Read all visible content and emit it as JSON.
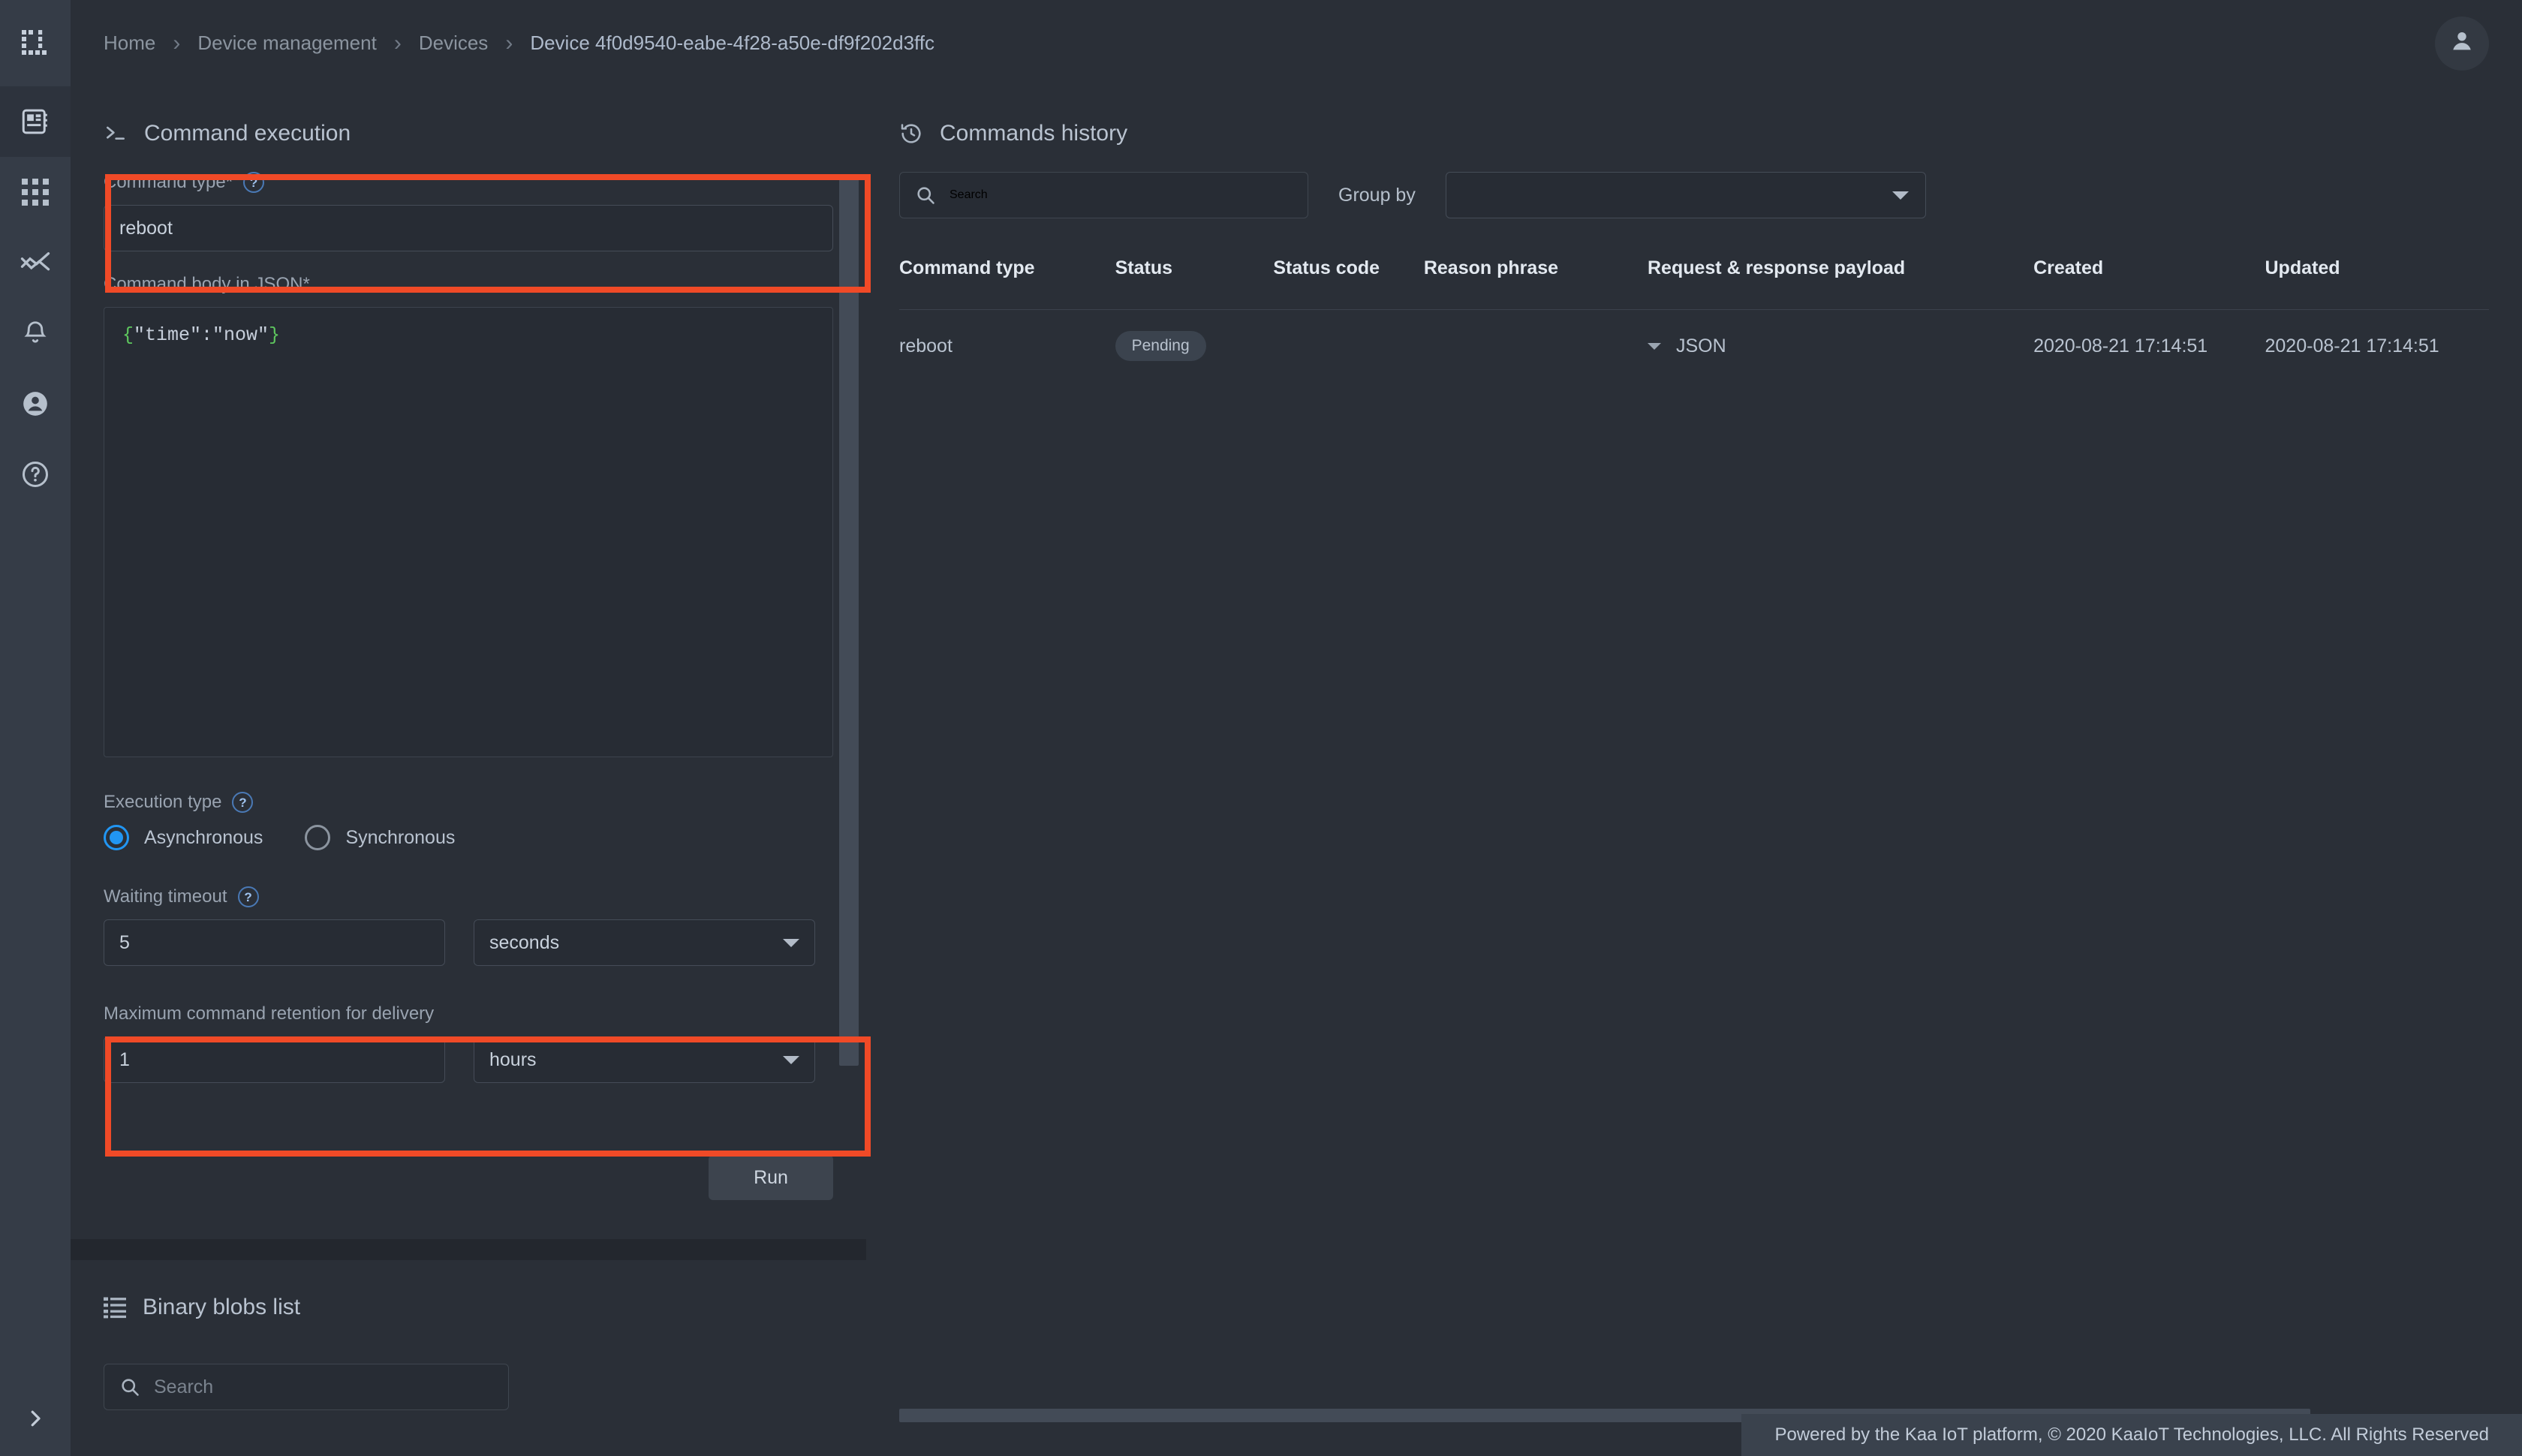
{
  "breadcrumb": {
    "items": [
      {
        "label": "Home"
      },
      {
        "label": "Device management"
      },
      {
        "label": "Devices"
      },
      {
        "label": "Device 4f0d9540-eabe-4f28-a50e-df9f202d3ffc"
      }
    ],
    "separator": "›"
  },
  "sidebar": {
    "items": [
      {
        "icon": "device-card-icon",
        "name": "devices"
      },
      {
        "icon": "grid-apps-icon",
        "name": "applications"
      },
      {
        "icon": "analytics-icon",
        "name": "analytics"
      },
      {
        "icon": "bell-icon",
        "name": "notifications"
      },
      {
        "icon": "user-icon",
        "name": "users"
      },
      {
        "icon": "help-circle-icon",
        "name": "help"
      }
    ],
    "expand_icon": "chevron-right-icon"
  },
  "topbar": {
    "account_icon": "account-avatar-icon"
  },
  "command_execution": {
    "title": "Command execution",
    "title_icon": "terminal-prompt-icon",
    "command_type": {
      "label": "Command type*",
      "help_icon": "?",
      "value": "reboot",
      "placeholder": ""
    },
    "command_body": {
      "label": "Command body in JSON*",
      "brace_open": "{",
      "code": "\"time\":\"now\"",
      "brace_close": "}"
    },
    "execution_type": {
      "label": "Execution type",
      "help_icon": "?",
      "options": [
        {
          "label": "Asynchronous",
          "selected": true
        },
        {
          "label": "Synchronous",
          "selected": false
        }
      ]
    },
    "waiting_timeout": {
      "label": "Waiting timeout",
      "help_icon": "?",
      "value": "5",
      "unit": "seconds"
    },
    "retention": {
      "label": "Maximum command retention for delivery",
      "value": "1",
      "unit": "hours"
    },
    "run_button": "Run"
  },
  "binary_blobs": {
    "title": "Binary blobs list",
    "title_icon": "list-icon",
    "search_placeholder": "Search",
    "search_value": "",
    "search_icon": "search-icon"
  },
  "commands_history": {
    "title": "Commands history",
    "title_icon": "history-clock-icon",
    "search_placeholder": "Search",
    "search_value": "",
    "search_icon": "search-icon",
    "group_by_label": "Group by",
    "group_by_value": "",
    "columns": [
      "Command type",
      "Status",
      "Status code",
      "Reason phrase",
      "Request & response payload",
      "Created",
      "Updated"
    ],
    "rows": [
      {
        "command_type": "reboot",
        "status": "Pending",
        "status_code": "",
        "reason_phrase": "",
        "payload": "JSON",
        "created": "2020-08-21 17:14:51",
        "updated": "2020-08-21 17:14:51"
      }
    ]
  },
  "footer": {
    "text": "Powered by the Kaa IoT platform, © 2020 KaaIoT Technologies, LLC. All Rights Reserved"
  },
  "colors": {
    "highlight": "#f04a27",
    "accent_blue": "#2196f3",
    "code_brace_green": "#5ec75e",
    "panel_bg": "#2a2f37",
    "page_bg": "#23272e",
    "rail_bg": "#353c47"
  }
}
